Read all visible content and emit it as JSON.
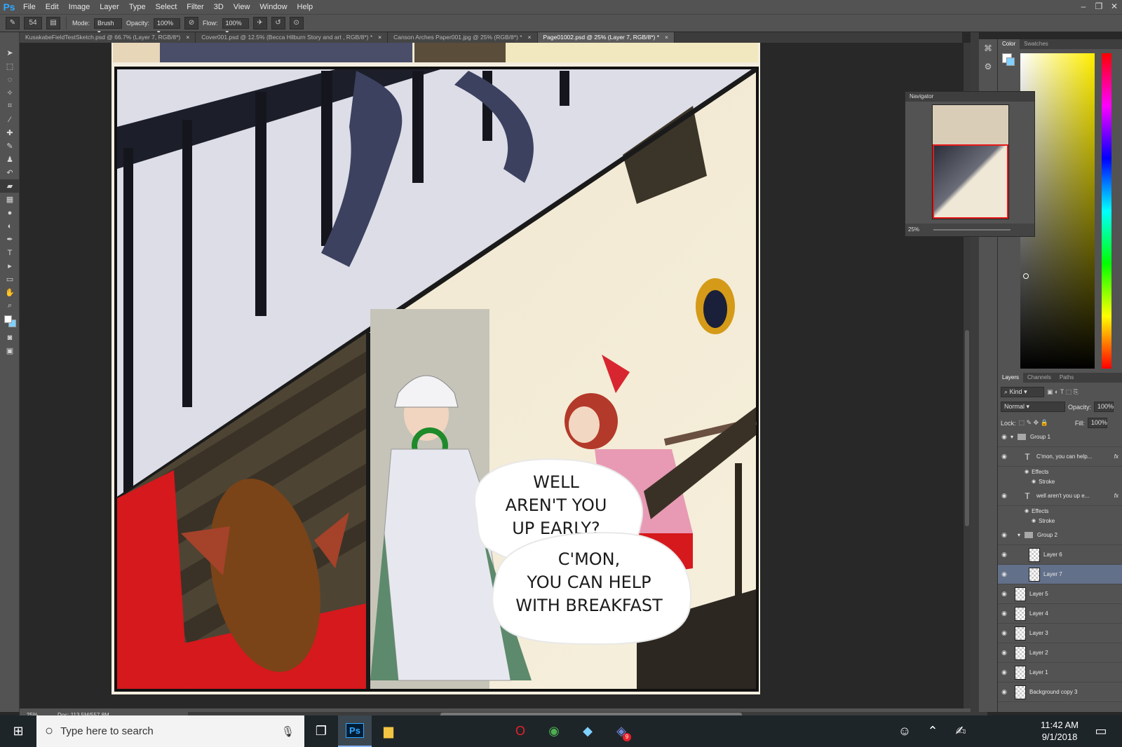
{
  "app": {
    "logo": "Ps",
    "menu": [
      "File",
      "Edit",
      "Image",
      "Layer",
      "Type",
      "Select",
      "Filter",
      "3D",
      "View",
      "Window",
      "Help"
    ]
  },
  "window_controls": [
    "–",
    "❐",
    "✕"
  ],
  "options_bar": {
    "brush_size": "54",
    "mode_label": "Mode:",
    "mode_value": "Brush",
    "opacity_label": "Opacity:",
    "opacity_value": "100%",
    "flow_label": "Flow:",
    "flow_value": "100%"
  },
  "doc_tabs": [
    {
      "label": "KusakabeFieldTestSketch.psd @ 66.7% (Layer 7, RGB/8*)",
      "active": false
    },
    {
      "label": "Cover001.psd @ 12.5% (Becca Hilburn Story and art , RGB/8*) *",
      "active": false
    },
    {
      "label": "Canson Arches Paper001.jpg @ 25% (RGB/8*) *",
      "active": false
    },
    {
      "label": "Page01002.psd @ 25% (Layer 7, RGB/8*) *",
      "active": true
    }
  ],
  "canvas": {
    "bubble1": [
      "WELL",
      "AREN'T YOU",
      "UP EARLY?"
    ],
    "bubble2": [
      "C'MON,",
      "YOU CAN HELP",
      "WITH BREAKFAST"
    ]
  },
  "status": {
    "zoom": "25%",
    "doc": "Doc: 113.5M/557.8M"
  },
  "navigator": {
    "title": "Navigator",
    "zoom": "25%"
  },
  "color_panel": {
    "tabs": [
      "Color",
      "Swatches"
    ]
  },
  "layers_panel": {
    "tabs": [
      "Layers",
      "Channels",
      "Paths"
    ],
    "kind_label": "Kind",
    "blend_mode": "Normal",
    "opacity_label": "Opacity:",
    "opacity_value": "100%",
    "lock_label": "Lock:",
    "fill_label": "Fill:",
    "fill_value": "100%",
    "layers": [
      {
        "name": "Group 1",
        "kind": "group",
        "indent": 0
      },
      {
        "name": "C'mon, you can help...",
        "kind": "text",
        "indent": 1
      },
      {
        "name": "Effects",
        "kind": "sub",
        "indent": 2
      },
      {
        "name": "Stroke",
        "kind": "sub",
        "indent": 3
      },
      {
        "name": "well aren't you up e...",
        "kind": "text",
        "indent": 1
      },
      {
        "name": "Effects",
        "kind": "sub",
        "indent": 2
      },
      {
        "name": "Stroke",
        "kind": "sub",
        "indent": 3
      },
      {
        "name": "Group 2",
        "kind": "group",
        "indent": 1
      },
      {
        "name": "Layer 6",
        "kind": "pixel",
        "indent": 2
      },
      {
        "name": "Layer 7",
        "kind": "pixel",
        "indent": 2,
        "selected": true
      },
      {
        "name": "Layer 5",
        "kind": "pixel",
        "indent": 0
      },
      {
        "name": "Layer 4",
        "kind": "pixel",
        "indent": 0
      },
      {
        "name": "Layer 3",
        "kind": "pixel",
        "indent": 0
      },
      {
        "name": "Layer 2",
        "kind": "pixel",
        "indent": 0
      },
      {
        "name": "Layer 1",
        "kind": "pixel",
        "indent": 0
      },
      {
        "name": "Background copy 3",
        "kind": "pixel",
        "indent": 0
      }
    ]
  },
  "taskbar": {
    "search_placeholder": "Type here to search",
    "time": "11:42 AM",
    "date": "9/1/2018",
    "discord_badge": "9"
  },
  "colors": {
    "ps_blue": "#31a8ff",
    "selected_layer": "#63708a",
    "navigator_frame": "#e81b1b"
  }
}
